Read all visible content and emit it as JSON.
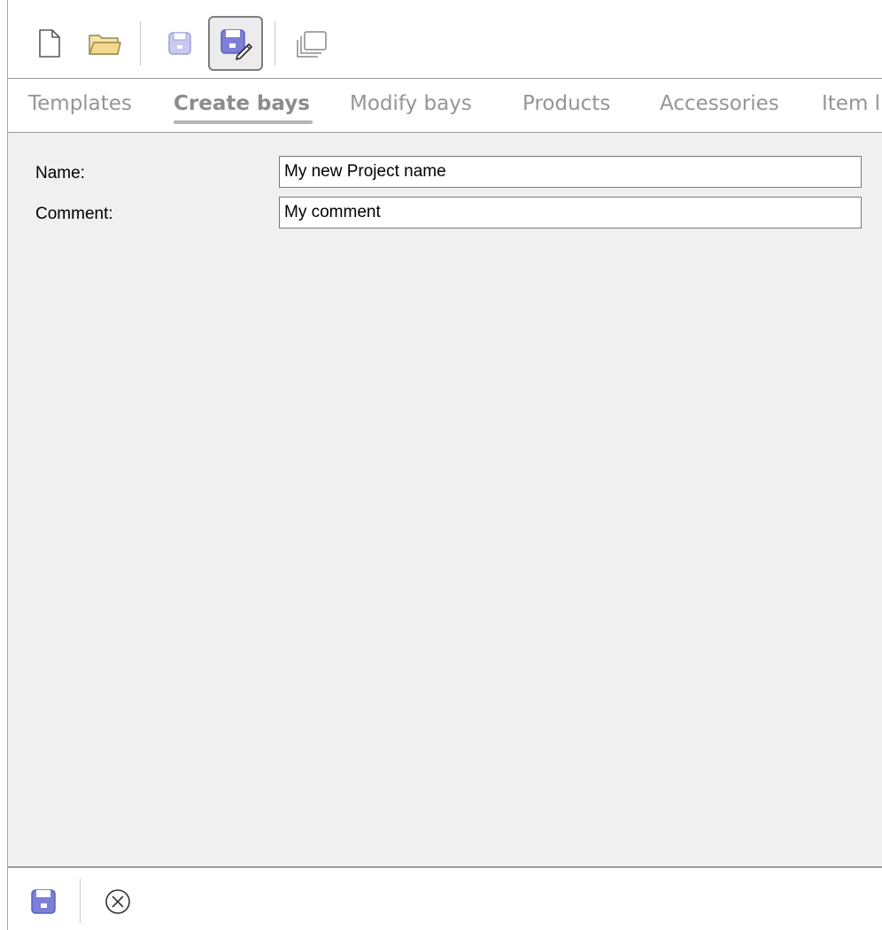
{
  "toolbar": {
    "buttons": [
      {
        "icon": "new-document-icon"
      },
      {
        "icon": "open-folder-icon"
      },
      {
        "icon": "save-icon"
      },
      {
        "icon": "save-as-edit-icon",
        "active": true
      },
      {
        "icon": "copy-pages-icon"
      }
    ]
  },
  "tabs": [
    {
      "label": "Templates",
      "selected": false
    },
    {
      "label": "Create bays",
      "selected": true
    },
    {
      "label": "Modify bays",
      "selected": false
    },
    {
      "label": "Products",
      "selected": false
    },
    {
      "label": "Accessories",
      "selected": false
    },
    {
      "label": "Item l",
      "selected": false
    }
  ],
  "form": {
    "name_label": "Name:",
    "name_value": "My new Project name",
    "comment_label": "Comment:",
    "comment_value": "My comment"
  },
  "footer": {
    "buttons": [
      {
        "icon": "save-icon"
      },
      {
        "icon": "cancel-circle-x-icon"
      }
    ]
  },
  "colors": {
    "accent": "#7b7fd6",
    "accent_light": "#c9caee",
    "folder": "#f3d98c",
    "content_bg": "#f0f0f0"
  }
}
